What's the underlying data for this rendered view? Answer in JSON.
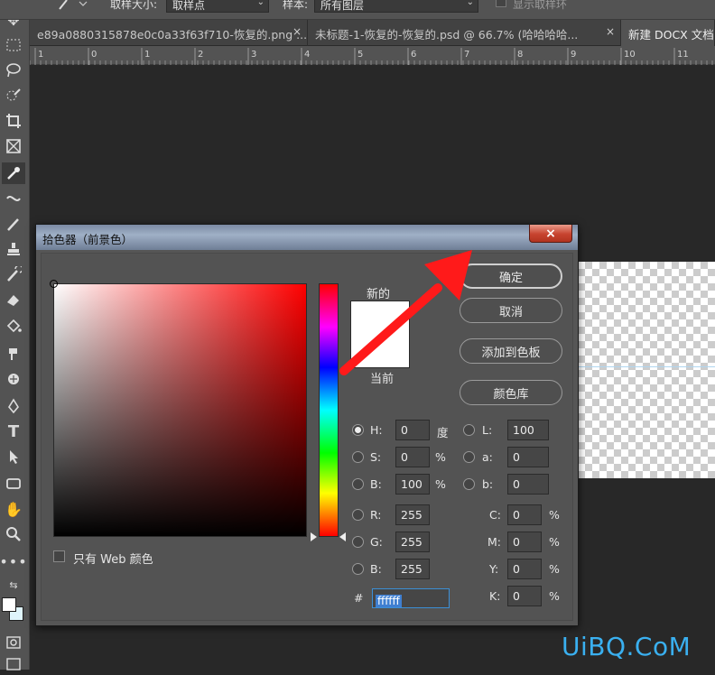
{
  "options_bar": {
    "sample_size_label": "取样大小:",
    "sample_size_value": "取样点",
    "sample_label": "样本:",
    "sample_value": "所有图层",
    "show_ring_label": "显示取样环"
  },
  "tabs": [
    {
      "label": "e89a0880315878e0c0a33f63f710-恢复的.png ...",
      "close": "×"
    },
    {
      "label": "未标题-1-恢复的-恢复的.psd @ 66.7% (哈哈哈哈...",
      "close": "×"
    },
    {
      "label": "新建 DOCX 文档",
      "close": ""
    }
  ],
  "ruler_labels": [
    "1",
    "0",
    "1",
    "2",
    "3",
    "4",
    "5",
    "6",
    "7",
    "8",
    "9",
    "10",
    "11"
  ],
  "dialog": {
    "title": "拾色器（前景色）",
    "close_icon": "×",
    "buttons": {
      "ok": "确定",
      "cancel": "取消",
      "add_swatch": "添加到色板",
      "color_library": "颜色库"
    },
    "new_label": "新的",
    "current_label": "当前",
    "web_only_label": "只有 Web 颜色",
    "fields": {
      "H": {
        "label": "H:",
        "value": "0",
        "unit": "度"
      },
      "S": {
        "label": "S:",
        "value": "0",
        "unit": "%"
      },
      "Bv": {
        "label": "B:",
        "value": "100",
        "unit": "%"
      },
      "R": {
        "label": "R:",
        "value": "255"
      },
      "G": {
        "label": "G:",
        "value": "255"
      },
      "Bc": {
        "label": "B:",
        "value": "255"
      },
      "L": {
        "label": "L:",
        "value": "100"
      },
      "a": {
        "label": "a:",
        "value": "0"
      },
      "b": {
        "label": "b:",
        "value": "0"
      },
      "C": {
        "label": "C:",
        "value": "0",
        "unit": "%"
      },
      "M": {
        "label": "M:",
        "value": "0",
        "unit": "%"
      },
      "Y": {
        "label": "Y:",
        "value": "0",
        "unit": "%"
      },
      "K": {
        "label": "K:",
        "value": "0",
        "unit": "%"
      },
      "hex_label": "#",
      "hex": "ffffff"
    },
    "selected_color": "#ffffff",
    "hue_color": "#ff0000"
  },
  "watermark": "UiBQ.CoM"
}
